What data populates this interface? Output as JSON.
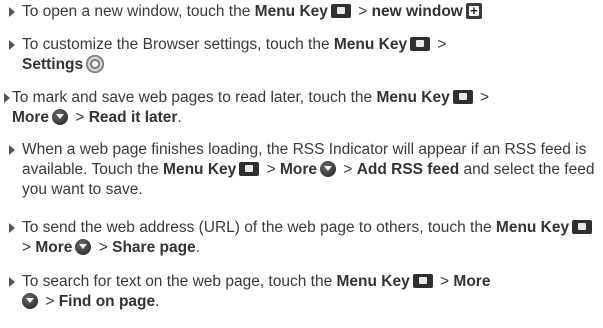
{
  "items": [
    {
      "pre": "To open a new window, touch the",
      "menu_key": "Menu Key",
      "sep": ">",
      "target": "new window"
    },
    {
      "pre": "To customize the Browser settings, touch the",
      "menu_key": "Menu Key",
      "sep": ">",
      "target": "Settings"
    },
    {
      "pre": "To mark and save web pages to read later, touch the",
      "menu_key": "Menu Key",
      "sep": ">",
      "more": "More",
      "sep2": ">",
      "target": "Read it later",
      "post": "."
    },
    {
      "pre": "When a web page finishes loading, the RSS Indicator will appear if an RSS feed is available. Touch the",
      "menu_key": "Menu Key",
      "sep": ">",
      "more": "More",
      "sep2": ">",
      "target": "Add RSS feed",
      "post": "and select the feed you want to save."
    },
    {
      "pre": "To send the web address (URL) of the web page to others, touch the",
      "menu_key": "Menu Key",
      "sep": ">",
      "more": "More",
      "sep2": ">",
      "target": "Share page",
      "post": "."
    },
    {
      "pre": "To search for text on the web page, touch the",
      "menu_key": "Menu Key",
      "sep": ">",
      "more": "More",
      "sep2": ">",
      "target": "Find on page",
      "post": "."
    }
  ],
  "icons": {
    "menu_key": "menu-key-icon",
    "new_window": "new-window-icon",
    "settings": "settings-icon",
    "more": "more-icon"
  }
}
